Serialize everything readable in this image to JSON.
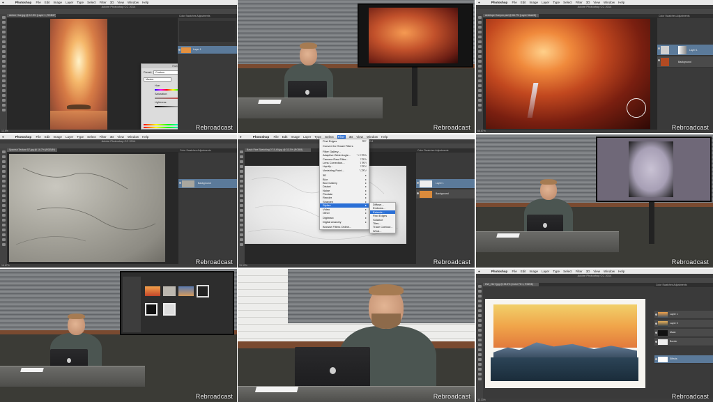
{
  "watermark": "Rebroadcast",
  "photoshop_menubar": {
    "app_name": "Photoshop",
    "items": [
      "File",
      "Edit",
      "Image",
      "Layer",
      "Type",
      "Select",
      "Filter",
      "3D",
      "View",
      "Window",
      "Help"
    ],
    "window_title": "Adobe Photoshop CC 2014"
  },
  "cells": {
    "c1": {
      "doc_tab": "Amber Hue.jpg @ 12.5% (Layer 1, RGB/8*)",
      "layer_name": "Layer 1",
      "status": "12.5%",
      "dialog": {
        "title": "Hue/Saturation",
        "preset_label": "Preset:",
        "preset_value": "Custom",
        "channel_value": "Master",
        "hue_label": "Hue:",
        "hue_value": "0",
        "saturation_label": "Saturation:",
        "saturation_value": "86",
        "lightness_label": "Lightness:",
        "lightness_value": "0",
        "ok_label": "OK",
        "cancel_label": "Cancel",
        "colorize_label": "Colorize",
        "preview_label": "Preview"
      }
    },
    "c3": {
      "doc_tab": "Antelope Canyon.psd @ 66.7% (Layer Mask/8)",
      "layer_names": [
        "Layer 1",
        "Background"
      ],
      "status": "66.67%"
    },
    "c4": {
      "doc_tab": "Spanish Texture 57.jpg @ 16.7% (RGB/8*)",
      "layer_name": "Background",
      "status": "16.67%"
    },
    "c5": {
      "doc_tab": "Basic Fine Sketching 07 8-49.jpg @ 33.3% (RGB/8)",
      "menu_title": "Filter",
      "filter_menu": [
        {
          "label": "Find Edges",
          "shortcut": "⌘F"
        },
        {
          "sep": true
        },
        {
          "label": "Convert for Smart Filters",
          "shortcut": ""
        },
        {
          "sep": true
        },
        {
          "label": "Filter Gallery...",
          "shortcut": ""
        },
        {
          "label": "Adaptive Wide Angle...",
          "shortcut": "⌥⇧⌘A"
        },
        {
          "label": "Camera Raw Filter...",
          "shortcut": "⇧⌘A"
        },
        {
          "label": "Lens Correction...",
          "shortcut": "⇧⌘R"
        },
        {
          "label": "Liquify...",
          "shortcut": "⇧⌘X"
        },
        {
          "label": "Vanishing Point...",
          "shortcut": "⌥⌘V"
        },
        {
          "sep": true
        },
        {
          "label": "3D",
          "shortcut": "▸"
        },
        {
          "label": "Blur",
          "shortcut": "▸"
        },
        {
          "label": "Blur Gallery",
          "shortcut": "▸"
        },
        {
          "label": "Distort",
          "shortcut": "▸"
        },
        {
          "label": "Noise",
          "shortcut": "▸"
        },
        {
          "label": "Pixelate",
          "shortcut": "▸"
        },
        {
          "label": "Render",
          "shortcut": "▸"
        },
        {
          "label": "Sharpen",
          "shortcut": "▸"
        },
        {
          "label": "Stylize",
          "shortcut": "▸",
          "highlight": true
        },
        {
          "label": "Video",
          "shortcut": "▸"
        },
        {
          "label": "Other",
          "shortcut": "▸"
        },
        {
          "sep": true
        },
        {
          "label": "Digimarc",
          "shortcut": "▸"
        },
        {
          "label": "Digital Anarchy",
          "shortcut": "▸"
        },
        {
          "sep": true
        },
        {
          "label": "Browse Filters Online...",
          "shortcut": ""
        }
      ],
      "stylize_submenu": [
        {
          "label": "Diffuse..."
        },
        {
          "label": "Emboss..."
        },
        {
          "label": "Extrude...",
          "highlight": true
        },
        {
          "label": "Find Edges"
        },
        {
          "label": "Solarize"
        },
        {
          "label": "Tiles..."
        },
        {
          "label": "Trace Contour..."
        },
        {
          "label": "Wind..."
        }
      ],
      "layer_names": [
        "Layer 1",
        "Background"
      ],
      "status": "33.33%"
    },
    "c9": {
      "doc_tab": "DW_2117.jpg @ 33.3% (Color Fill 1, RGB/8)",
      "layer_names": [
        "Layer 1",
        "Layer 0",
        "Mask",
        "Border",
        "Effects"
      ],
      "status": "33.33%"
    }
  },
  "colors": {
    "menu_highlight": "#2a6fd6",
    "layer_selected": "#5b7a9a",
    "studio_trim": "#7a4a30"
  }
}
